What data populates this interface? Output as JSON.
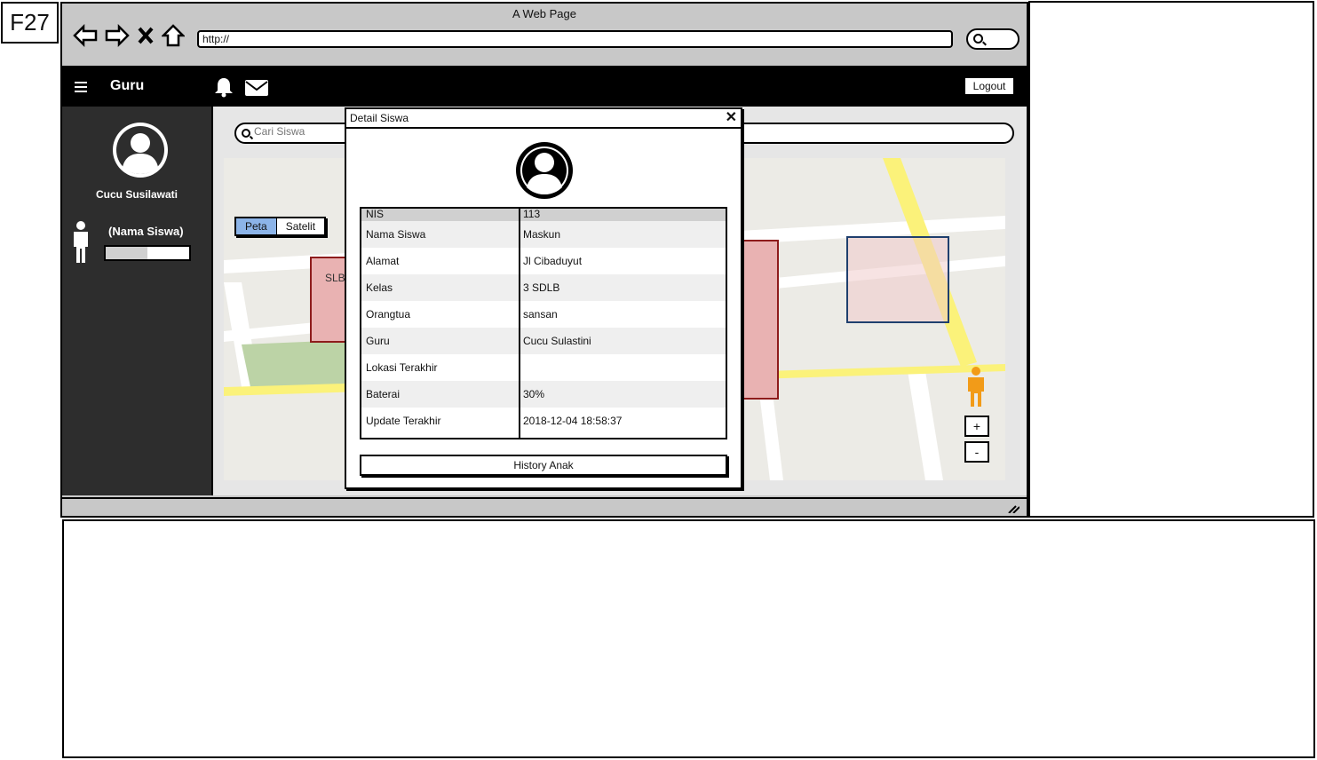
{
  "frame_label": "F27",
  "browser": {
    "title": "A Web Page",
    "url": "http://"
  },
  "topbar": {
    "title": "Guru",
    "logout_label": "Logout"
  },
  "sidebar": {
    "user_name": "Cucu Susilawati",
    "student_name": "(Nama Siswa)",
    "battery_level": 0.5
  },
  "search": {
    "placeholder": "Cari Siswa"
  },
  "map": {
    "toggle": [
      "Peta",
      "Satelit"
    ],
    "active_toggle": "Peta",
    "label_slb": "SLB",
    "zoom_in": "+",
    "zoom_out": "-",
    "person_color": "#f29b18"
  },
  "modal": {
    "title": "Detail Siswa",
    "close": "✕",
    "rows": [
      {
        "label": "NIS",
        "value": "113"
      },
      {
        "label": "Nama Siswa",
        "value": "Maskun"
      },
      {
        "label": "Alamat",
        "value": "Jl Cibaduyut"
      },
      {
        "label": "Kelas",
        "value": "3 SDLB"
      },
      {
        "label": "Orangtua",
        "value": "sansan"
      },
      {
        "label": "Guru",
        "value": "Cucu Sulastini"
      },
      {
        "label": "Lokasi Terakhir",
        "value": ""
      },
      {
        "label": "Baterai",
        "value": "30%"
      },
      {
        "label": "Update Terakhir",
        "value": "2018-12-04 18:58:37"
      }
    ],
    "history_button": "History Anak"
  }
}
